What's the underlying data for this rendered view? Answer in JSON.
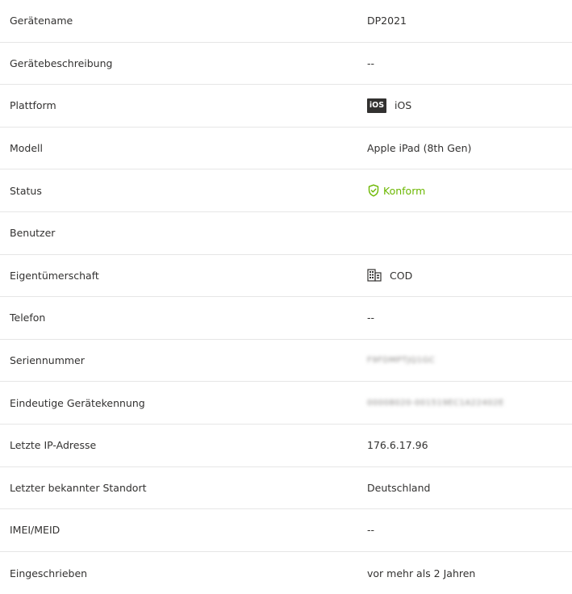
{
  "properties": [
    {
      "label": "Gerätename",
      "value": "DP2021"
    },
    {
      "label": "Gerätebeschreibung",
      "value": "--"
    },
    {
      "label": "Plattform",
      "badge": "iOS",
      "value": "iOS"
    },
    {
      "label": "Modell",
      "value": "Apple iPad (8th Gen)"
    },
    {
      "label": "Status",
      "value": "Konform"
    },
    {
      "label": "Benutzer",
      "value": ""
    },
    {
      "label": "Eigentümerschaft",
      "value": "COD"
    },
    {
      "label": "Telefon",
      "value": "--"
    },
    {
      "label": "Seriennummer",
      "value": "F9FDMPTJQ1GC"
    },
    {
      "label": "Eindeutige Gerätekennung",
      "value": "00008020-001519EC1A22402E"
    },
    {
      "label": "Letzte IP-Adresse",
      "value": "176.6.17.96"
    },
    {
      "label": "Letzter bekannter Standort",
      "value": "Deutschland"
    },
    {
      "label": "IMEI/MEID",
      "value": "--"
    },
    {
      "label": "Eingeschrieben",
      "value": "vor mehr als 2 Jahren"
    }
  ],
  "colors": {
    "compliant": "#6bb700",
    "text": "#323130",
    "divider": "#e6e6e6"
  },
  "icons": {
    "status": "shield-check-icon",
    "ownership": "building-icon",
    "platform": "ios-badge-icon"
  }
}
